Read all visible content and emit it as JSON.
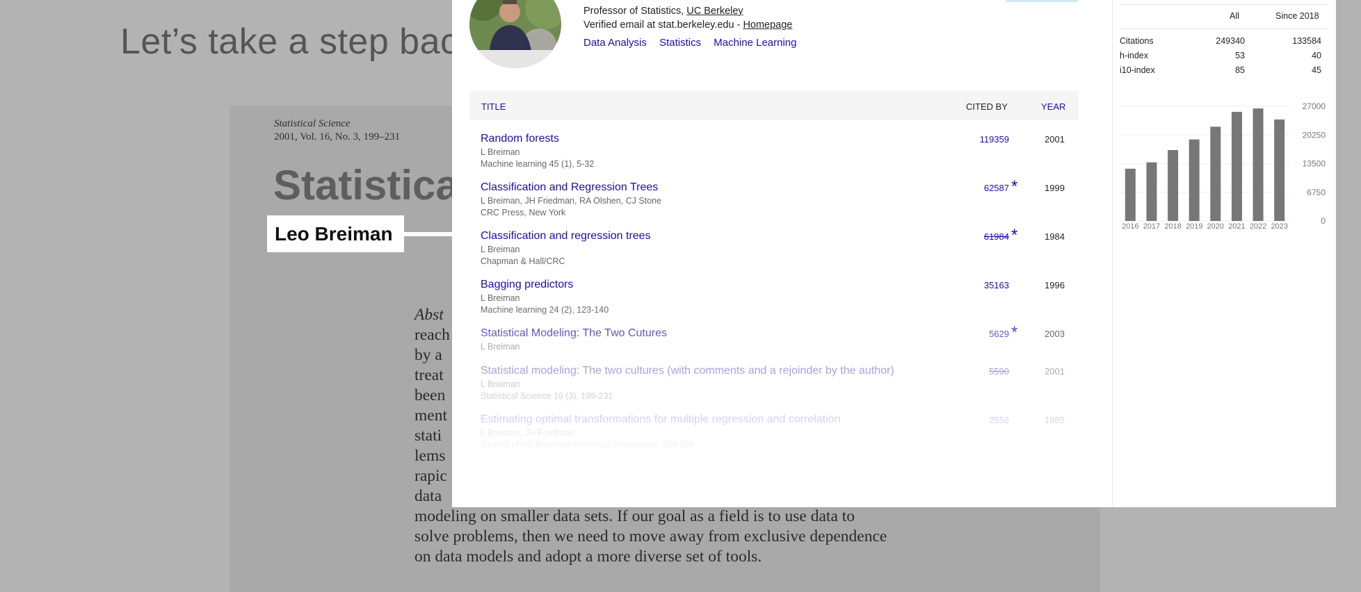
{
  "slide": {
    "title": "Let’s take a step back",
    "paper": {
      "journal": "Statistical Science",
      "volume": "2001, Vol. 16, No. 3, 199–231",
      "title": "Statistica",
      "author": "Leo Breiman",
      "abstract_lines": [
        "Abst",
        "reach",
        "by a",
        "treat",
        "been",
        "ment",
        "stati",
        "lems",
        "rapic",
        "data",
        "modeling on smaller data sets. If our goal as a field is to use data to",
        "solve problems, then we need to move away from exclusive dependence",
        "on data models and adopt a more diverse set of tools."
      ]
    }
  },
  "profile": {
    "affiliation_prefix": "Professor of Statistics, ",
    "affiliation_link": "UC Berkeley",
    "email_text": "Verified email at stat.berkeley.edu - ",
    "homepage_link": "Homepage",
    "interests": [
      "Data Analysis",
      "Statistics",
      "Machine Learning"
    ]
  },
  "table": {
    "col_title": "TITLE",
    "col_cited": "CITED BY",
    "col_year": "YEAR",
    "articles": [
      {
        "title": "Random forests",
        "authors": "L Breiman",
        "venue": "Machine learning 45 (1), 5-32",
        "cited": "119359",
        "year": "2001",
        "star": "",
        "strike": false
      },
      {
        "title": "Classification and Regression Trees",
        "authors": "L Breiman, JH Friedman, RA Olshen, CJ Stone",
        "venue": "CRC Press, New York",
        "cited": "62587",
        "year": "1999",
        "star": "*",
        "strike": false
      },
      {
        "title": "Classification and regression trees",
        "authors": "L Breiman",
        "venue": "Chapman & Hall/CRC",
        "cited": "61984",
        "year": "1984",
        "star": "*",
        "strike": true
      },
      {
        "title": "Bagging predictors",
        "authors": "L Breiman",
        "venue": "Machine learning 24 (2), 123-140",
        "cited": "35163",
        "year": "1996",
        "star": "",
        "strike": false
      },
      {
        "title": "Statistical Modeling: The Two Cutures",
        "authors": "L Breiman",
        "venue": "",
        "cited": "5629",
        "year": "2003",
        "star": "*",
        "strike": false
      },
      {
        "title": "Statistical modeling: The two cultures (with comments and a rejoinder by the author)",
        "authors": "L Breiman",
        "venue": "Statistical Science 16 (3), 199-231",
        "cited": "5590",
        "year": "2001",
        "star": "",
        "strike": true
      },
      {
        "title": "Estimating optimal transformations for multiple regression and correlation",
        "authors": "L Breiman, JH Friedman",
        "venue": "Journal of the American Statistical Association, 580-598",
        "cited": "2556",
        "year": "1985",
        "star": "",
        "strike": false
      }
    ]
  },
  "stats": {
    "col_all": "All",
    "col_since": "Since 2018",
    "rows": [
      {
        "label": "Citations",
        "all": "249340",
        "since": "133584"
      },
      {
        "label": "h-index",
        "all": "53",
        "since": "40"
      },
      {
        "label": "i10-index",
        "all": "85",
        "since": "45"
      }
    ]
  },
  "chart_data": {
    "type": "bar",
    "categories": [
      "2016",
      "2017",
      "2018",
      "2019",
      "2020",
      "2021",
      "2022",
      "2023"
    ],
    "values": [
      12300,
      13800,
      16700,
      19200,
      22200,
      25700,
      26500,
      23900
    ],
    "yticks": [
      "27000",
      "20250",
      "13500",
      "6750",
      "0"
    ],
    "ylim": [
      0,
      27000
    ],
    "bar_color": "#777777"
  }
}
